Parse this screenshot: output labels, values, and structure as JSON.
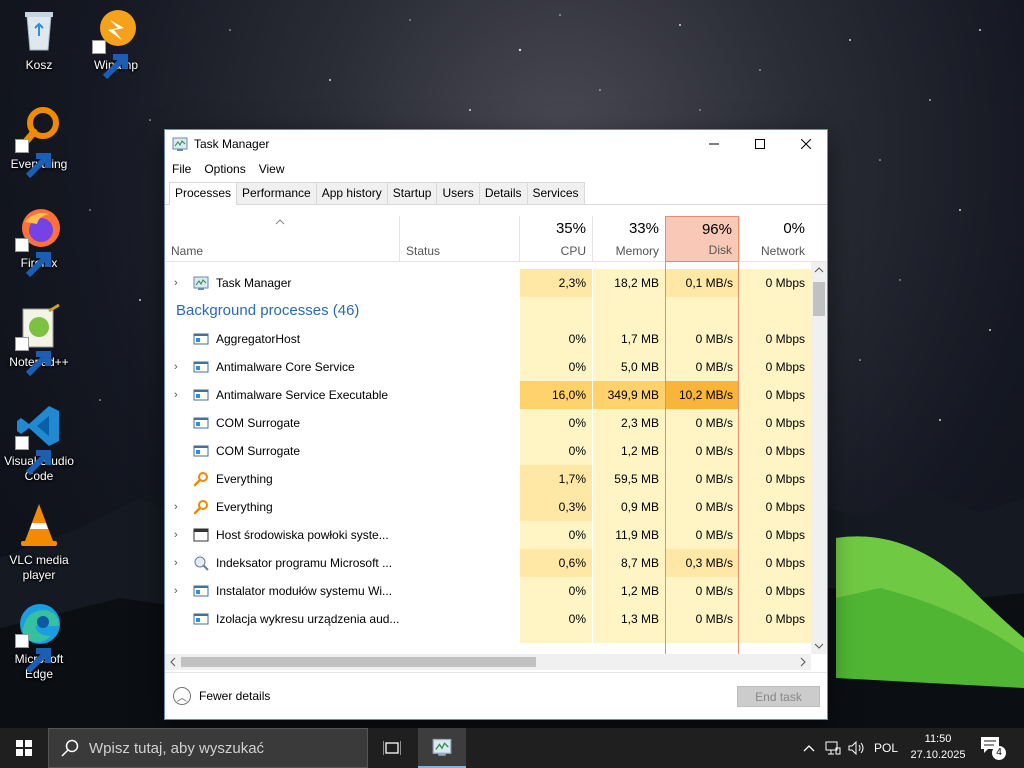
{
  "desktop": {
    "icons": [
      {
        "label": "Kosz",
        "icon": "recycle-bin-icon"
      },
      {
        "label": "Winamp",
        "icon": "winamp-icon"
      },
      {
        "label": "Everything",
        "icon": "everything-icon"
      },
      {
        "label": "Firefox",
        "icon": "firefox-icon"
      },
      {
        "label": "Notepad++",
        "icon": "notepad-plus-plus-icon"
      },
      {
        "label": "Visual Studio Code",
        "icon": "vscode-icon"
      },
      {
        "label": "VLC media player",
        "icon": "vlc-icon"
      },
      {
        "label": "Microsoft Edge",
        "icon": "edge-icon"
      }
    ]
  },
  "window": {
    "title": "Task Manager",
    "menu": [
      "File",
      "Options",
      "View"
    ],
    "tabs": [
      "Processes",
      "Performance",
      "App history",
      "Startup",
      "Users",
      "Details",
      "Services"
    ],
    "active_tab": "Processes",
    "columns": {
      "name": "Name",
      "status": "Status",
      "cpu": {
        "pct": "35%",
        "label": "CPU"
      },
      "memory": {
        "pct": "33%",
        "label": "Memory"
      },
      "disk": {
        "pct": "96%",
        "label": "Disk"
      },
      "network": {
        "pct": "0%",
        "label": "Network"
      }
    },
    "app_row": {
      "name": "Task Manager",
      "cpu": "2,3%",
      "memory": "18,2 MB",
      "disk": "0,1 MB/s",
      "network": "0 Mbps"
    },
    "group_title": "Background processes (46)",
    "processes": [
      {
        "name": "AggregatorHost",
        "expand": false,
        "icon": "service-icon",
        "cpu": "0%",
        "memory": "1,7 MB",
        "disk": "0 MB/s",
        "network": "0 Mbps"
      },
      {
        "name": "Antimalware Core Service",
        "expand": true,
        "icon": "service-icon",
        "cpu": "0%",
        "memory": "5,0 MB",
        "disk": "0 MB/s",
        "network": "0 Mbps"
      },
      {
        "name": "Antimalware Service Executable",
        "expand": true,
        "icon": "service-icon",
        "cpu": "16,0%",
        "memory": "349,9 MB",
        "disk": "10,2 MB/s",
        "network": "0 Mbps"
      },
      {
        "name": "COM Surrogate",
        "expand": false,
        "icon": "service-icon",
        "cpu": "0%",
        "memory": "2,3 MB",
        "disk": "0 MB/s",
        "network": "0 Mbps"
      },
      {
        "name": "COM Surrogate",
        "expand": false,
        "icon": "service-icon",
        "cpu": "0%",
        "memory": "1,2 MB",
        "disk": "0 MB/s",
        "network": "0 Mbps"
      },
      {
        "name": "Everything",
        "expand": false,
        "icon": "everything-icon",
        "cpu": "1,7%",
        "memory": "59,5 MB",
        "disk": "0 MB/s",
        "network": "0 Mbps"
      },
      {
        "name": "Everything",
        "expand": true,
        "icon": "everything-icon",
        "cpu": "0,3%",
        "memory": "0,9 MB",
        "disk": "0 MB/s",
        "network": "0 Mbps"
      },
      {
        "name": "Host środowiska powłoki syste...",
        "expand": true,
        "icon": "window-icon",
        "cpu": "0%",
        "memory": "11,9 MB",
        "disk": "0 MB/s",
        "network": "0 Mbps"
      },
      {
        "name": "Indeksator programu Microsoft ...",
        "expand": true,
        "icon": "indexer-icon",
        "cpu": "0,6%",
        "memory": "8,7 MB",
        "disk": "0,3 MB/s",
        "network": "0 Mbps"
      },
      {
        "name": "Instalator modułów systemu Wi...",
        "expand": true,
        "icon": "service-icon",
        "cpu": "0%",
        "memory": "1,2 MB",
        "disk": "0 MB/s",
        "network": "0 Mbps"
      },
      {
        "name": "Izolacja wykresu urządzenia aud...",
        "expand": false,
        "icon": "service-icon",
        "cpu": "0%",
        "memory": "1,3 MB",
        "disk": "0 MB/s",
        "network": "0 Mbps"
      }
    ],
    "footer": {
      "fewer_details": "Fewer details",
      "end_task": "End task"
    }
  },
  "taskbar": {
    "search_placeholder": "Wpisz tutaj, aby wyszukać",
    "language": "POL",
    "time": "11:50",
    "date": "27.10.2025",
    "notifications": "4"
  },
  "colors": {
    "heat_light": "#fff4c4",
    "heat_mid": "#ffe8a6",
    "heat_strong": "#ffd26b",
    "heat_hot": "#f9b43a",
    "disk_header": "#f9c8b6",
    "group_blue": "#2a6ab3"
  }
}
